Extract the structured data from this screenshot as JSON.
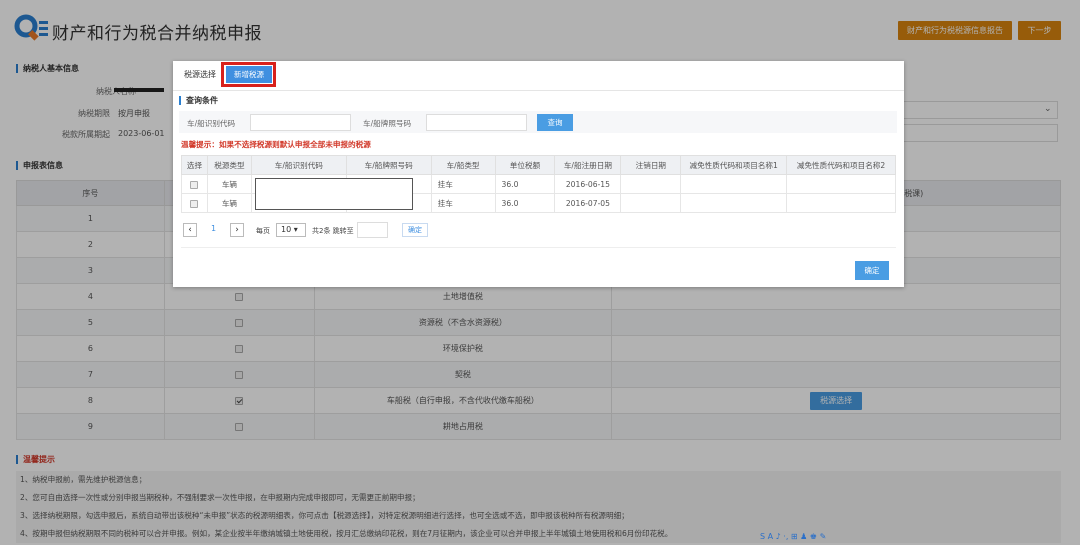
{
  "header": {
    "title": "财产和行为税合并纳税申报",
    "report_button": "财产和行为税税源信息报告",
    "next_button": "下一步"
  },
  "basic_info": {
    "section_title": "纳税人基本信息",
    "name_label": "纳税人名称",
    "period_label": "纳税期限",
    "period_value": "按月申报",
    "date_label": "税款所属期起",
    "date_value": "2023-06-01"
  },
  "declaration": {
    "section_title": "申报表信息",
    "col_index": "序号",
    "col_extra": "税课)",
    "rows": [
      {
        "idx": "1",
        "name": "",
        "checked": false,
        "action": ""
      },
      {
        "idx": "2",
        "name": "",
        "checked": false,
        "action": ""
      },
      {
        "idx": "3",
        "name": "",
        "checked": false,
        "action": ""
      },
      {
        "idx": "4",
        "name": "土地增值税",
        "checked": false,
        "action": ""
      },
      {
        "idx": "5",
        "name": "资源税（不含水资源税）",
        "checked": false,
        "action": ""
      },
      {
        "idx": "6",
        "name": "环境保护税",
        "checked": false,
        "action": ""
      },
      {
        "idx": "7",
        "name": "契税",
        "checked": false,
        "action": ""
      },
      {
        "idx": "8",
        "name": "车船税（自行申报，不含代收代缴车船税）",
        "checked": true,
        "action": "税源选择"
      },
      {
        "idx": "9",
        "name": "耕地占用税",
        "checked": false,
        "action": ""
      }
    ]
  },
  "tips": {
    "section_title": "温馨提示",
    "items": [
      "1、纳税申报前，需先维护税源信息；",
      "2、您可自由选择一次性或分别申报当期税种，不强制要求一次性申报，在申报期内完成申报即可，无需更正前期申报；",
      "3、选择纳税期限，勾选申报后，系统自动带出该税种“未申报”状态的税源明细表，你可点击【税源选择】，对特定税源明细进行选择，也可全选或不选，即申报该税种所有税源明细；",
      "4、按期申报但纳税期限不同的税种可以合并申报。例如，某企业按半年缴纳城镇土地使用税，按月汇总缴纳印花税，则在7月征期内，该企业可以合并申报上半年城镇土地使用税和6月份印花税。"
    ]
  },
  "modal": {
    "tab_label": "税源选择",
    "add_button": "新增税源",
    "query_title": "查询条件",
    "field1_label": "车/船识别代码",
    "field2_label": "车/船牌照号码",
    "query_button": "查询",
    "warning": "温馨提示：如果不选择税源则默认申报全部未申报的税源",
    "columns": [
      "选择",
      "税源类型",
      "车/船识别代码",
      "车/船牌照号码",
      "车/船类型",
      "单位税额",
      "车/船注册日期",
      "注销日期",
      "减免性质代码和项目名称1",
      "减免性质代码和项目名称2"
    ],
    "rows": [
      {
        "type": "车辆",
        "vtype": "挂车",
        "rate": "36.0",
        "date": "2016-06-15"
      },
      {
        "type": "车辆",
        "vtype": "挂车",
        "rate": "36.0",
        "date": "2016-07-05"
      }
    ],
    "pagination": {
      "page": "1",
      "per_page_label": "每页",
      "per_page": "10",
      "total_label": "共2条 跳转至",
      "go_button": "确定"
    },
    "confirm_button": "确定"
  },
  "ime_bar": "S A ♪ ·, ⊞ ♟ ♚ ✎"
}
